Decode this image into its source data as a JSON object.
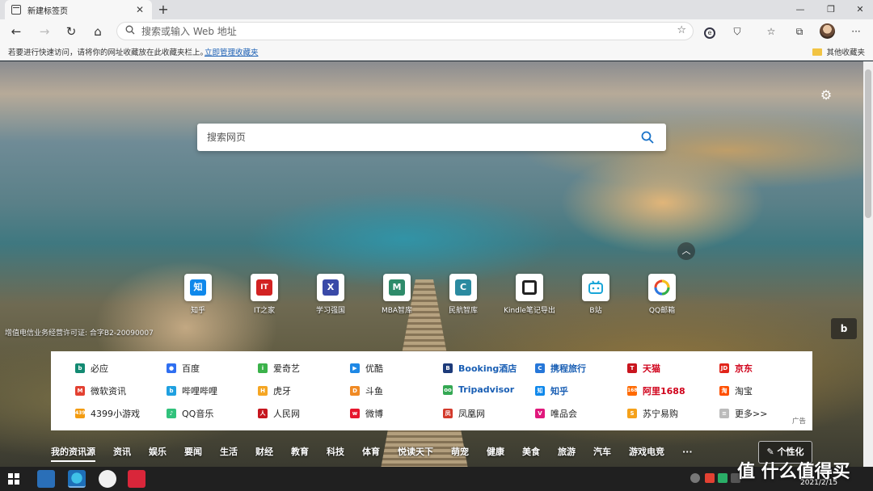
{
  "tab": {
    "title": "新建标签页"
  },
  "address": {
    "placeholder": "搜索或输入 Web 地址"
  },
  "bookmarks": {
    "hint": "若要进行快速访问，请将你的网址收藏放在此收藏夹栏上。",
    "manage": "立即管理收藏夹",
    "other": "其他收藏夹"
  },
  "search": {
    "placeholder": "搜索网页"
  },
  "quick_links": [
    "知乎",
    "IT之家",
    "学习强国",
    "MBA智库",
    "民航智库",
    "Kindle笔记导出",
    "B站",
    "QQ邮箱"
  ],
  "quick_glyphs": [
    "知",
    "IT",
    "X",
    "M",
    "C",
    "",
    "",
    ""
  ],
  "license": "增值电信业务经营许可证: 合字B2-20090007",
  "sites": [
    [
      "必应",
      "百度",
      "爱奇艺",
      "优酷",
      "Booking酒店",
      "携程旅行",
      "天猫",
      "京东"
    ],
    [
      "微软资讯",
      "哔哩哔哩",
      "虎牙",
      "斗鱼",
      "Tripadvisor",
      "知乎",
      "阿里1688",
      "淘宝"
    ],
    [
      "4399小游戏",
      "QQ音乐",
      "人民网",
      "微博",
      "凤凰网",
      "唯品会",
      "苏宁易购",
      "更多>>"
    ]
  ],
  "ad_label": "广告",
  "categories": [
    "我的资讯源",
    "资讯",
    "娱乐",
    "要闻",
    "生活",
    "财经",
    "教育",
    "科技",
    "体育",
    "悦读天下",
    "萌宠",
    "健康",
    "美食",
    "旅游",
    "汽车",
    "游戏电竞",
    "···"
  ],
  "personalize": "✎ 个性化",
  "clock": "2021/2/15",
  "watermark": "值 什么值得买"
}
